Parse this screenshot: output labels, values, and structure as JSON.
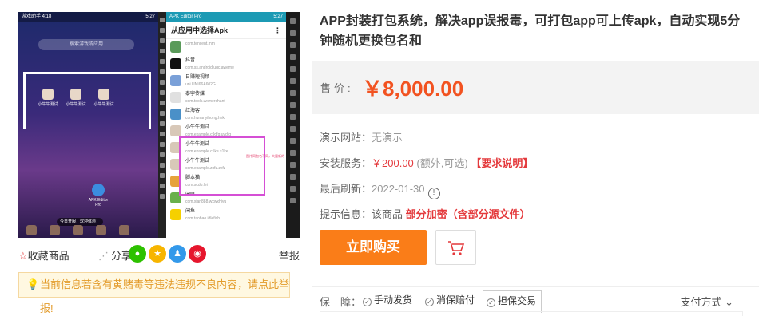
{
  "preview": {
    "left_phone": {
      "status_left": "游戏助手 4:18",
      "status_time": "5:27",
      "search_placeholder": "搜索游戏或应用",
      "apps": [
        {
          "label": "小牛牛测试"
        },
        {
          "label": "小牛牛测试"
        },
        {
          "label": "小牛牛测试"
        }
      ],
      "editor_label": "APK Editor Pro",
      "toast": "今日开服，欢迎体验！"
    },
    "right_phone": {
      "status_title": "APK Editor Pro",
      "status_time": "5:27",
      "header": "从应用中选择Apk",
      "items": [
        {
          "name": "",
          "pkg": "com.tencent.mm"
        },
        {
          "name": "抖音",
          "pkg": "com.ss.android.ugc.aweme"
        },
        {
          "name": "日赚短视频",
          "pkg": "uni.UNI66A602G"
        },
        {
          "name": "泰宇传媒",
          "pkg": "com.tools.wxmerchant"
        },
        {
          "name": "红海客",
          "pkg": "com.hunanyihong.hhk"
        },
        {
          "name": "小牛牛测试",
          "pkg": "com.example.c9dfg.uvdfg"
        },
        {
          "name": "小牛牛测试",
          "pkg": "com.example.c1ke.s1ke"
        },
        {
          "name": "小牛牛测试",
          "pkg": "com.example.zxfz.zxfz"
        },
        {
          "name": "脚本猫",
          "pkg": "com.scdo.lei"
        },
        {
          "name": "闲匣",
          "pkg": "com.xian888.wxwxhjyu"
        },
        {
          "name": "闲鱼",
          "pkg": "com.taobao.idlefish"
        }
      ],
      "note": "图片同包名不同，大量新的"
    }
  },
  "share_row": {
    "favorite": "收藏商品",
    "share": "分享:",
    "report": "举报"
  },
  "warning": "当前信息若含有黄赌毒等违法违规不良内容，请点此举报!",
  "product": {
    "title": "APP封装打包系统，解决app误报毒，可打包app可上传apk，自动实现5分钟随机更换包名和",
    "price_label": "售价:",
    "price": "￥8,000.00",
    "demo_label": "演示网站：",
    "demo_value": "无演示",
    "install_label": "安装服务：",
    "install_price": "￥200.00",
    "install_note": "(额外,可选)",
    "install_link": "【要求说明】",
    "refresh_label": "最后刷新：",
    "refresh_date": "2022-01-30",
    "tip_label": "提示信息：",
    "tip_prefix": "该商品",
    "tip_highlight": "部分加密（含部分源文件）",
    "buy_button": "立即购买",
    "guarantee_label": "保　障：",
    "guarantees": [
      "手动发货",
      "消保赔付",
      "担保交易"
    ],
    "pay_methods": "支付方式"
  },
  "colors": {
    "price": "#f25220",
    "buy_button": "#fa7d18",
    "highlight_red": "#e4393c",
    "warning_text": "#e39b2a"
  }
}
